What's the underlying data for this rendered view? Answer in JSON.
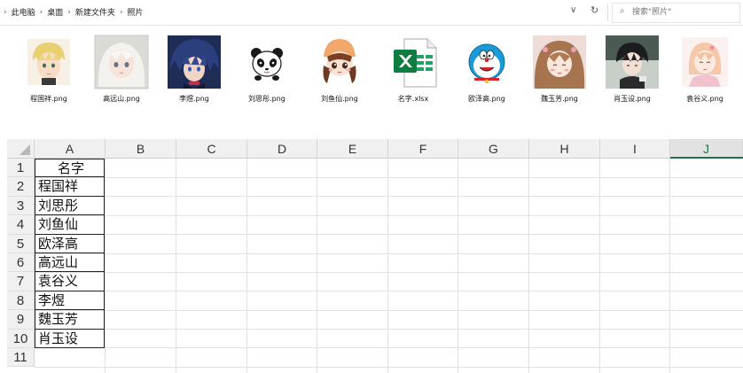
{
  "breadcrumb": {
    "items": [
      "此电脑",
      "桌面",
      "新建文件夹",
      "照片"
    ]
  },
  "search": {
    "placeholder": "搜索\"照片\""
  },
  "files": [
    {
      "name": "程国祥.png",
      "icon": "blonde-anime-boy-avatar"
    },
    {
      "name": "高远山.png",
      "icon": "white-hair-anime-girl-avatar"
    },
    {
      "name": "李煜.png",
      "icon": "blue-hair-anime-boy-avatar"
    },
    {
      "name": "刘思彤.png",
      "icon": "panda-avatar"
    },
    {
      "name": "刘鱼仙.png",
      "icon": "chibi-girl-avatar"
    },
    {
      "name": "名字.xlsx",
      "icon": "excel-file-icon"
    },
    {
      "name": "欧泽高.png",
      "icon": "doraemon-avatar"
    },
    {
      "name": "魏玉芳.png",
      "icon": "brown-hair-anime-girl-avatar"
    },
    {
      "name": "肖玉设.png",
      "icon": "dark-anime-boy-avatar"
    },
    {
      "name": "袁谷义.png",
      "icon": "pink-anime-girl-avatar"
    }
  ],
  "spreadsheet": {
    "columns": [
      "A",
      "B",
      "C",
      "D",
      "E",
      "F",
      "G",
      "H",
      "I",
      "J"
    ],
    "rows": [
      "1",
      "2",
      "3",
      "4",
      "5",
      "6",
      "7",
      "8",
      "9",
      "10",
      "11"
    ],
    "column_a": [
      "名字",
      "程国祥",
      "刘思彤",
      "刘鱼仙",
      "欧泽高",
      "高远山",
      "袁谷义",
      "李煜",
      "魏玉芳",
      "肖玉设",
      ""
    ],
    "selected_column": "J",
    "accent_color": "#217346"
  }
}
